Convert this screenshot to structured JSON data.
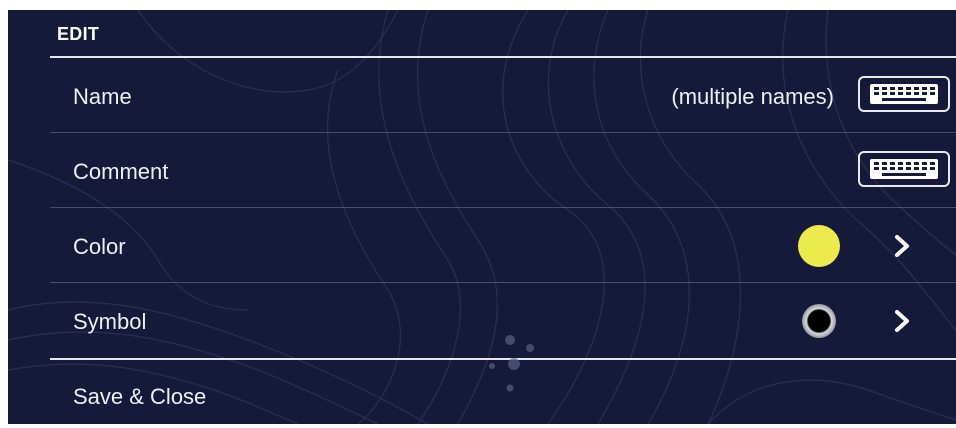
{
  "header": {
    "title": "EDIT"
  },
  "rows": [
    {
      "label": "Name",
      "value": "(multiple names)",
      "action_icon": "keyboard-icon"
    },
    {
      "label": "Comment",
      "value": "",
      "action_icon": "keyboard-icon"
    },
    {
      "label": "Color",
      "color": "#ecea4c",
      "action_icon": "chevron-right-icon"
    },
    {
      "label": "Symbol",
      "symbol": "black-circle",
      "action_icon": "chevron-right-icon"
    }
  ],
  "footer": {
    "save_label": "Save & Close"
  },
  "colors": {
    "background": "#161a3a",
    "text": "#eef0f6",
    "divider": "#e6e8ef",
    "selected_color": "#ecea4c"
  }
}
